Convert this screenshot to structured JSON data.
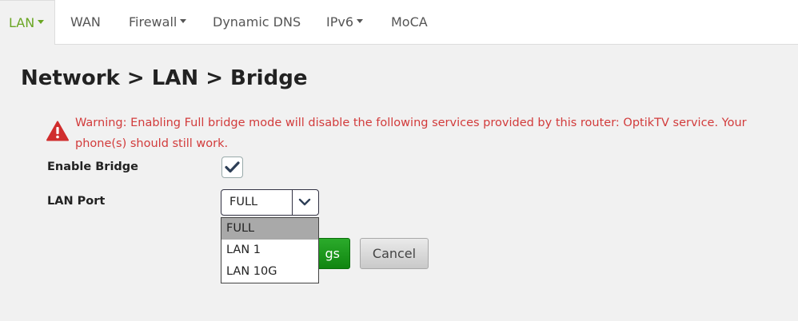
{
  "nav": {
    "tabs": [
      {
        "label": "LAN",
        "has_caret": true,
        "active": true
      },
      {
        "label": "WAN",
        "has_caret": false
      },
      {
        "label": "Firewall",
        "has_caret": true
      },
      {
        "label": "Dynamic DNS",
        "has_caret": false
      },
      {
        "label": "IPv6",
        "has_caret": true
      },
      {
        "label": "MoCA",
        "has_caret": false
      }
    ]
  },
  "page": {
    "title": "Network > LAN > Bridge"
  },
  "warning": {
    "icon": "warning-triangle-icon",
    "text": "Warning: Enabling Full bridge mode will disable the following services provided by this router: OptikTV service. Your phone(s) should still work."
  },
  "form": {
    "enable_bridge": {
      "label": "Enable Bridge",
      "checked": true
    },
    "lan_port": {
      "label": "LAN Port",
      "value": "FULL",
      "options": [
        "FULL",
        "LAN 1",
        "LAN 10G"
      ]
    }
  },
  "buttons": {
    "save_visible_fragment": "gs",
    "cancel": "Cancel"
  },
  "colors": {
    "accent_green": "#6aa624",
    "warning_red": "#d23b3b",
    "save_green": "#1a9a1a"
  }
}
